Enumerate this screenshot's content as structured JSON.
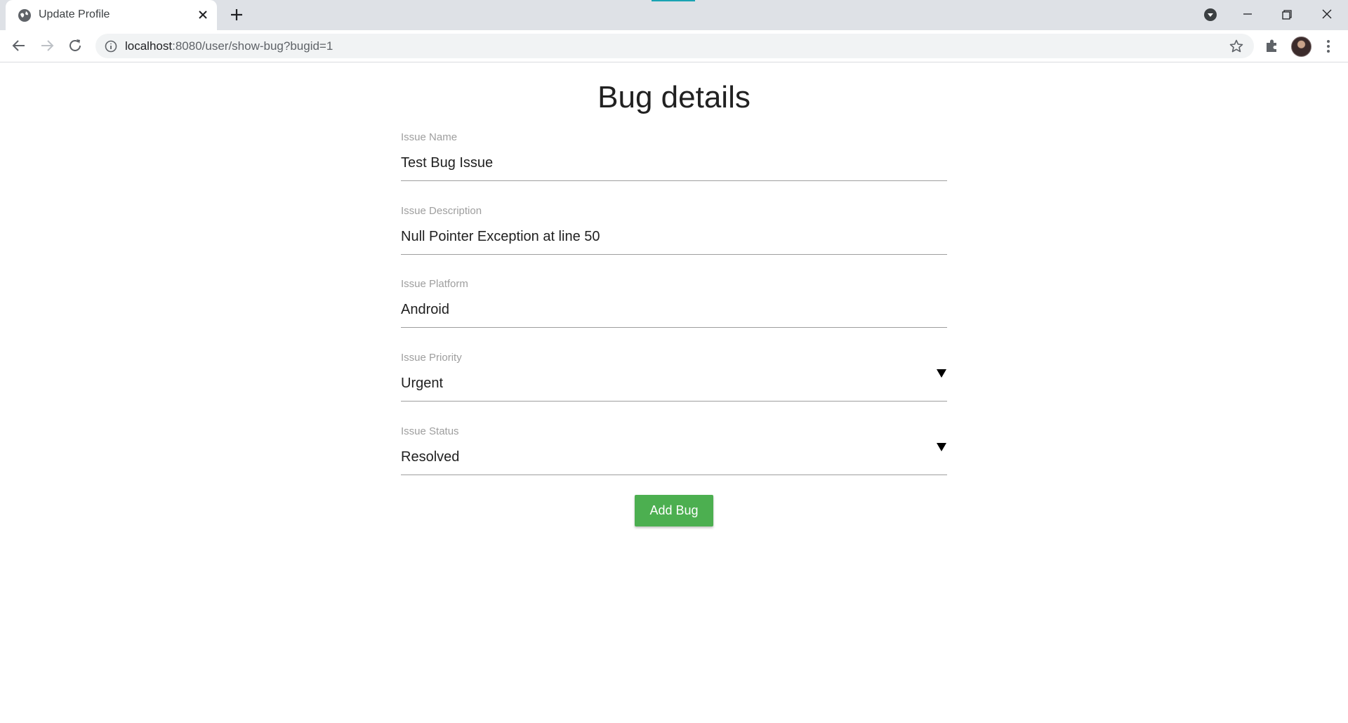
{
  "browser": {
    "tab_title": "Update Profile",
    "url_host": "localhost",
    "url_rest": ":8080/user/show-bug?bugid=1"
  },
  "page": {
    "title": "Bug details",
    "fields": [
      {
        "label": "Issue Name",
        "value": "Test Bug Issue"
      },
      {
        "label": "Issue Description",
        "value": "Null Pointer Exception at line 50"
      },
      {
        "label": "Issue Platform",
        "value": "Android"
      },
      {
        "label": "Issue Priority",
        "value": "Urgent"
      },
      {
        "label": "Issue Status",
        "value": "Resolved"
      }
    ],
    "submit_label": "Add Bug"
  },
  "colors": {
    "button": "#4caf50",
    "tab_strip": "#dee1e6"
  },
  "icons": [
    "globe-icon",
    "close-icon",
    "plus-icon",
    "profile-dropdown-icon",
    "minimize-icon",
    "restore-icon",
    "window-close-icon",
    "back-icon",
    "forward-icon",
    "reload-icon",
    "info-icon",
    "star-icon",
    "puzzle-icon",
    "kebab-menu-icon",
    "caret-down-icon"
  ]
}
